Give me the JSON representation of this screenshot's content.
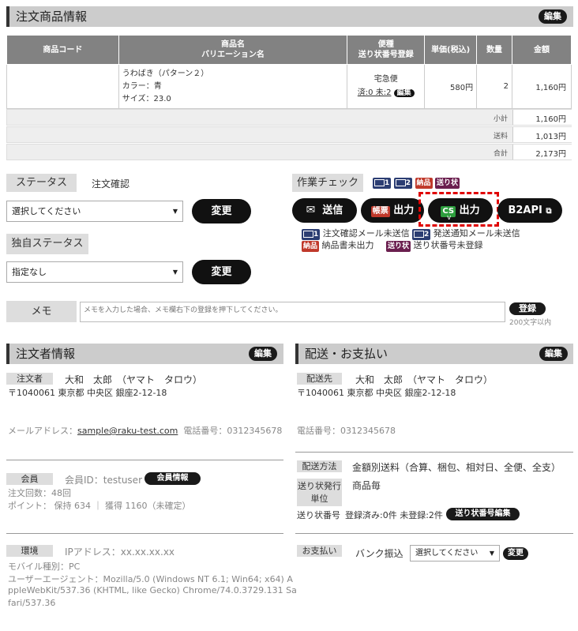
{
  "order_items": {
    "title": "注文商品情報",
    "edit_label": "編集",
    "columns": {
      "code": "商品コード",
      "name_line1": "商品名",
      "name_line2": "バリエーション名",
      "ship_line1": "便種",
      "ship_line2": "送り状番号登録",
      "price": "単価(税込)",
      "qty": "数量",
      "amount": "金額"
    },
    "rows": [
      {
        "code": "",
        "name": "うわばき（パターン２）",
        "color": "カラー：青",
        "size": "サイズ：23.0",
        "ship_type": "宅急便",
        "ship_status": "済:0  未:2",
        "ship_edit": "編集",
        "price": "580円",
        "qty": "2",
        "amount": "1,160円"
      }
    ],
    "totals": [
      {
        "label": "小計",
        "value": "1,160円"
      },
      {
        "label": "送料",
        "value": "1,013円"
      },
      {
        "label": "合計",
        "value": "2,173円"
      }
    ]
  },
  "status": {
    "label": "ステータス",
    "value": "注文確認",
    "select_value": "選択してください",
    "change_label": "変更"
  },
  "custom_status": {
    "label": "独自ステータス",
    "select_value": "指定なし",
    "change_label": "変更"
  },
  "work_check": {
    "label": "作業チェック",
    "tags": [
      "1",
      "2",
      "納品",
      "送り状"
    ],
    "buttons": {
      "send": "送信",
      "voucher_tag": "帳票",
      "voucher_out": "出力",
      "cs_tag": "CS",
      "cs_out": "出力",
      "b2api": "B2API"
    },
    "cursor_mark": "v",
    "legend": {
      "m1": "注文確認メール未送信",
      "m2": "発送通知メール未送信",
      "delivery": "納品書未出力",
      "slip": "送り状番号未登録"
    }
  },
  "memo": {
    "label": "メモ",
    "placeholder": "メモを入力した場合、メモ欄右下の登録を押下してください。",
    "register_label": "登録",
    "limit": "200文字以内"
  },
  "orderer": {
    "title": "注文者情報",
    "edit_label": "編集",
    "tag": "注文者",
    "name": "大和　太郎　（ヤマト　タロウ）",
    "address": "〒1040061  東京都  中央区  銀座2-12-18",
    "email_label": "メールアドレス：",
    "email": "sample@raku-test.com",
    "phone": "電話番号：0312345678",
    "member_tag": "会員",
    "member_id": "会員ID：testuser",
    "member_info_btn": "会員情報",
    "order_count": "注文回数：48回",
    "points": "ポイント：  保持 634  ｜  獲得 1160（未確定）",
    "env_tag": "環境",
    "ip": "IPアドレス：xx.xx.xx.xx",
    "device": "モバイル種別：PC",
    "ua_1": "ユーザーエージェント：Mozilla/5.0 (Windows NT 6.1; Win64; x64) A",
    "ua_2": "ppleWebKit/537.36 (KHTML, like Gecko) Chrome/74.0.3729.131 Sa",
    "ua_3": "fari/537.36"
  },
  "delivery": {
    "title": "配送・お支払い",
    "edit_label": "編集",
    "tag": "配送先",
    "name": "大和　太郎　（ヤマト　タロウ）",
    "address": "〒1040061  東京都  中央区  銀座2-12-18",
    "phone": "電話番号：0312345678",
    "method_tag": "配送方法",
    "method": "金額別送料（合算、梱包、相対日、全便、全支）",
    "unit_tag_1": "送り状発行",
    "unit_tag_2": "単位",
    "unit": "商品毎",
    "slip_label": "送り状番号",
    "slip_status": "登録済み:0件  未登録:2件",
    "slip_edit_btn": "送り状番号編集",
    "pay_tag": "お支払い",
    "pay_method": "バンク振込",
    "pay_select": "選択してください",
    "pay_change": "変更"
  }
}
